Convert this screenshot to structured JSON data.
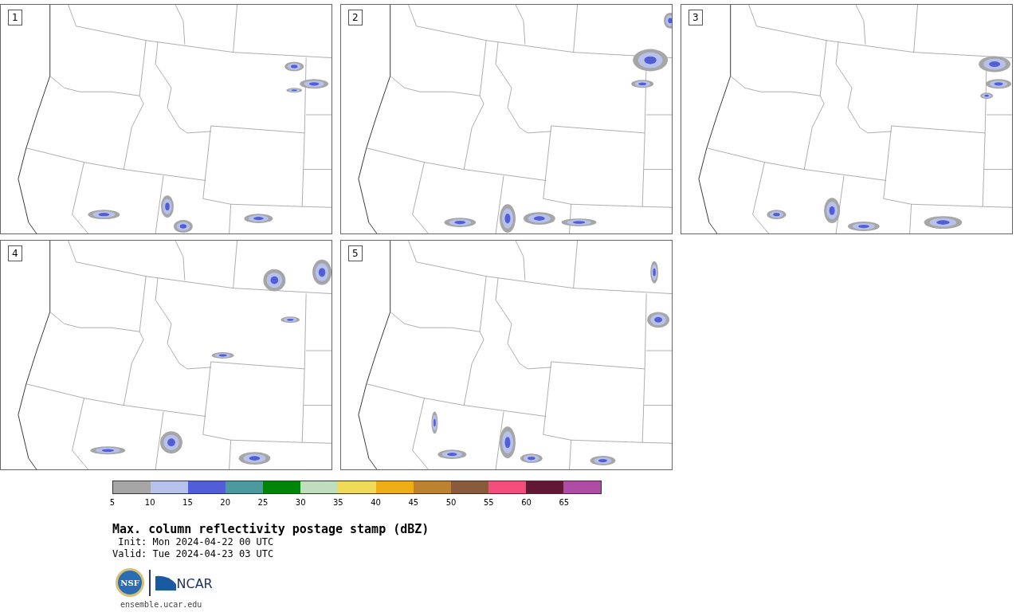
{
  "panels": [
    {
      "label": "1"
    },
    {
      "label": "2"
    },
    {
      "label": "3"
    },
    {
      "label": "4"
    },
    {
      "label": "5"
    }
  ],
  "colorbar": {
    "segments": [
      {
        "color": "#a6a6a6"
      },
      {
        "color": "#b7c2ec"
      },
      {
        "color": "#525ed8"
      },
      {
        "color": "#4c999f"
      },
      {
        "color": "#00850a"
      },
      {
        "color": "#bfdebd"
      },
      {
        "color": "#f0da5a"
      },
      {
        "color": "#efad17"
      },
      {
        "color": "#bd8230"
      },
      {
        "color": "#8a5a3c"
      },
      {
        "color": "#f34e7b"
      },
      {
        "color": "#621735"
      },
      {
        "color": "#ae4ca6"
      }
    ],
    "ticks": [
      "5",
      "10",
      "15",
      "20",
      "25",
      "30",
      "35",
      "40",
      "45",
      "50",
      "55",
      "60",
      "65"
    ]
  },
  "title": "Max. column reflectivity postage stamp (dBZ)",
  "init": " Init: Mon 2024-04-22 00 UTC",
  "valid": "Valid: Tue 2024-04-23 03 UTC",
  "logo": {
    "seal": "NSF",
    "wordmark": "NCAR"
  },
  "url": "ensemble.ucar.edu"
}
